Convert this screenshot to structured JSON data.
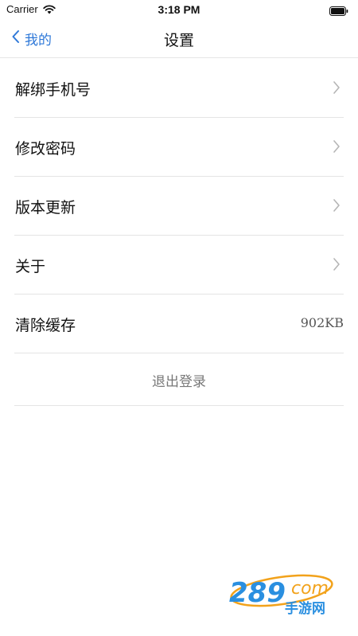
{
  "status_bar": {
    "carrier": "Carrier",
    "time": "3:18 PM"
  },
  "nav": {
    "back_label": "我的",
    "title": "设置"
  },
  "settings": {
    "items": [
      {
        "label": "解绑手机号"
      },
      {
        "label": "修改密码"
      },
      {
        "label": "版本更新"
      },
      {
        "label": "关于"
      },
      {
        "label": "清除缓存",
        "value": "902KB"
      }
    ],
    "logout_label": "退出登录"
  },
  "watermark": {
    "brand": "289com",
    "tagline": "手游网"
  },
  "colors": {
    "accent": "#2e78d8",
    "watermark_blue": "#2a8fe0",
    "watermark_orange": "#f2a21b"
  }
}
